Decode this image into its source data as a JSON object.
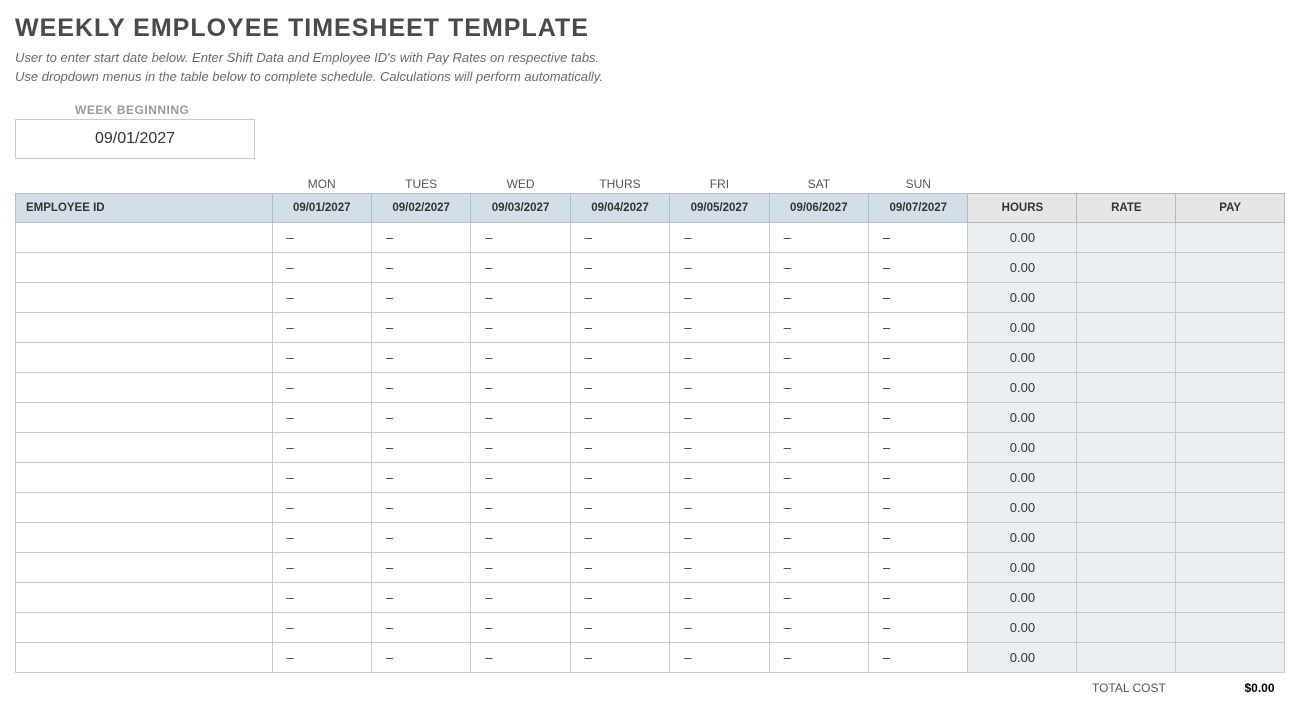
{
  "title": "WEEKLY EMPLOYEE TIMESHEET TEMPLATE",
  "instructions_line1": "User to enter start date below.  Enter Shift Data and Employee ID's with Pay Rates on respective tabs.",
  "instructions_line2": "Use dropdown menus in the table below to complete schedule. Calculations will perform automatically.",
  "week_beginning_label": "WEEK BEGINNING",
  "week_beginning_value": "09/01/2027",
  "days": [
    "MON",
    "TUES",
    "WED",
    "THURS",
    "FRI",
    "SAT",
    "SUN"
  ],
  "dates": [
    "09/01/2027",
    "09/02/2027",
    "09/03/2027",
    "09/04/2027",
    "09/05/2027",
    "09/06/2027",
    "09/07/2027"
  ],
  "columns": {
    "employee_id": "EMPLOYEE ID",
    "hours": "HOURS",
    "rate": "RATE",
    "pay": "PAY"
  },
  "rows": [
    {
      "employee_id": "",
      "d": [
        "–",
        "–",
        "–",
        "–",
        "–",
        "–",
        "–"
      ],
      "hours": "0.00",
      "rate": "",
      "pay": ""
    },
    {
      "employee_id": "",
      "d": [
        "–",
        "–",
        "–",
        "–",
        "–",
        "–",
        "–"
      ],
      "hours": "0.00",
      "rate": "",
      "pay": ""
    },
    {
      "employee_id": "",
      "d": [
        "–",
        "–",
        "–",
        "–",
        "–",
        "–",
        "–"
      ],
      "hours": "0.00",
      "rate": "",
      "pay": ""
    },
    {
      "employee_id": "",
      "d": [
        "–",
        "–",
        "–",
        "–",
        "–",
        "–",
        "–"
      ],
      "hours": "0.00",
      "rate": "",
      "pay": ""
    },
    {
      "employee_id": "",
      "d": [
        "–",
        "–",
        "–",
        "–",
        "–",
        "–",
        "–"
      ],
      "hours": "0.00",
      "rate": "",
      "pay": ""
    },
    {
      "employee_id": "",
      "d": [
        "–",
        "–",
        "–",
        "–",
        "–",
        "–",
        "–"
      ],
      "hours": "0.00",
      "rate": "",
      "pay": ""
    },
    {
      "employee_id": "",
      "d": [
        "–",
        "–",
        "–",
        "–",
        "–",
        "–",
        "–"
      ],
      "hours": "0.00",
      "rate": "",
      "pay": ""
    },
    {
      "employee_id": "",
      "d": [
        "–",
        "–",
        "–",
        "–",
        "–",
        "–",
        "–"
      ],
      "hours": "0.00",
      "rate": "",
      "pay": ""
    },
    {
      "employee_id": "",
      "d": [
        "–",
        "–",
        "–",
        "–",
        "–",
        "–",
        "–"
      ],
      "hours": "0.00",
      "rate": "",
      "pay": ""
    },
    {
      "employee_id": "",
      "d": [
        "–",
        "–",
        "–",
        "–",
        "–",
        "–",
        "–"
      ],
      "hours": "0.00",
      "rate": "",
      "pay": ""
    },
    {
      "employee_id": "",
      "d": [
        "–",
        "–",
        "–",
        "–",
        "–",
        "–",
        "–"
      ],
      "hours": "0.00",
      "rate": "",
      "pay": ""
    },
    {
      "employee_id": "",
      "d": [
        "–",
        "–",
        "–",
        "–",
        "–",
        "–",
        "–"
      ],
      "hours": "0.00",
      "rate": "",
      "pay": ""
    },
    {
      "employee_id": "",
      "d": [
        "–",
        "–",
        "–",
        "–",
        "–",
        "–",
        "–"
      ],
      "hours": "0.00",
      "rate": "",
      "pay": ""
    },
    {
      "employee_id": "",
      "d": [
        "–",
        "–",
        "–",
        "–",
        "–",
        "–",
        "–"
      ],
      "hours": "0.00",
      "rate": "",
      "pay": ""
    },
    {
      "employee_id": "",
      "d": [
        "–",
        "–",
        "–",
        "–",
        "–",
        "–",
        "–"
      ],
      "hours": "0.00",
      "rate": "",
      "pay": ""
    }
  ],
  "total_label": "TOTAL COST",
  "total_value": "$0.00"
}
